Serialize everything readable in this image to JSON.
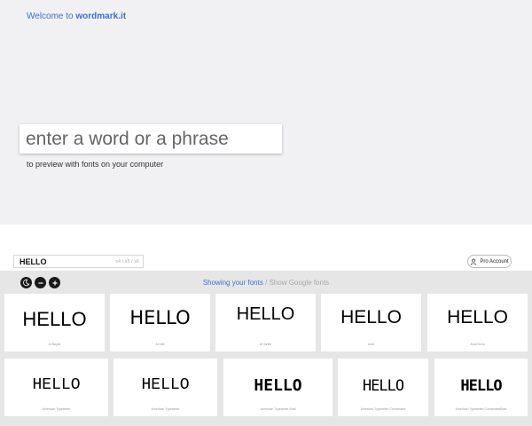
{
  "hero": {
    "welcome_prefix": "Welcome to",
    "welcome_brand": "wordmark.it",
    "input_placeholder": "enter a word or a phrase",
    "subtitle": "to preview with fonts on your computer"
  },
  "toolbar": {
    "text_value": "HELLO",
    "size_options": "s4 / s5 / s6",
    "pro_label": "Pro Account"
  },
  "source": {
    "active": "Showing your fonts",
    "separator": "/",
    "inactive": "Show Google fonts"
  },
  "controls": {
    "theme_icon": "moon-icon",
    "zoom_out_icon": "minus-icon",
    "zoom_in_icon": "plus-icon"
  },
  "cards": [
    {
      "sample": "HELLO",
      "font_name": "Al Bayan"
    },
    {
      "sample": "HELLO",
      "font_name": "Al Nile"
    },
    {
      "sample": "HELLO",
      "font_name": "Al Tarikh"
    },
    {
      "sample": "HELLO",
      "font_name": "Arial"
    },
    {
      "sample": "HELLO",
      "font_name": "Arial Nova"
    },
    {
      "sample": "HELLO",
      "font_name": "American Typewriter"
    },
    {
      "sample": "HELLO",
      "font_name": "American Typewriter"
    },
    {
      "sample": "HELLO",
      "font_name": "American Typewriter Bold"
    },
    {
      "sample": "HELLO",
      "font_name": "American Typewriter Condensed"
    },
    {
      "sample": "HELLO",
      "font_name": "American Typewriter CondensedBold"
    }
  ],
  "colors": {
    "accent": "#3b6fd8",
    "hero_bg": "#f1f1f3",
    "grid_bg": "#e6e6e6"
  }
}
